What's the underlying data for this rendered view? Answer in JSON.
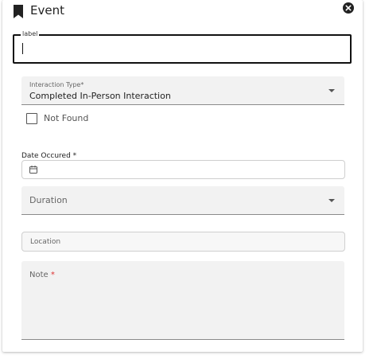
{
  "header": {
    "title": "Event",
    "icon": "bookmark-icon",
    "close_icon": "close-circle-icon"
  },
  "label_field": {
    "legend": "label",
    "value": ""
  },
  "interaction_type": {
    "label": "Interaction Type*",
    "selected": "Completed In-Person Interaction"
  },
  "not_found": {
    "label": "Not Found",
    "checked": false
  },
  "date_occured": {
    "label": "Date Occured *",
    "value": "",
    "icon": "calendar-icon"
  },
  "duration": {
    "placeholder": "Duration"
  },
  "location": {
    "placeholder": "Location",
    "value": ""
  },
  "note": {
    "label": "Note",
    "required_mark": "*",
    "value": ""
  },
  "colors": {
    "required": "#dd3333",
    "filled_background": "#f2f2f2",
    "focused_outline": "#111111"
  }
}
